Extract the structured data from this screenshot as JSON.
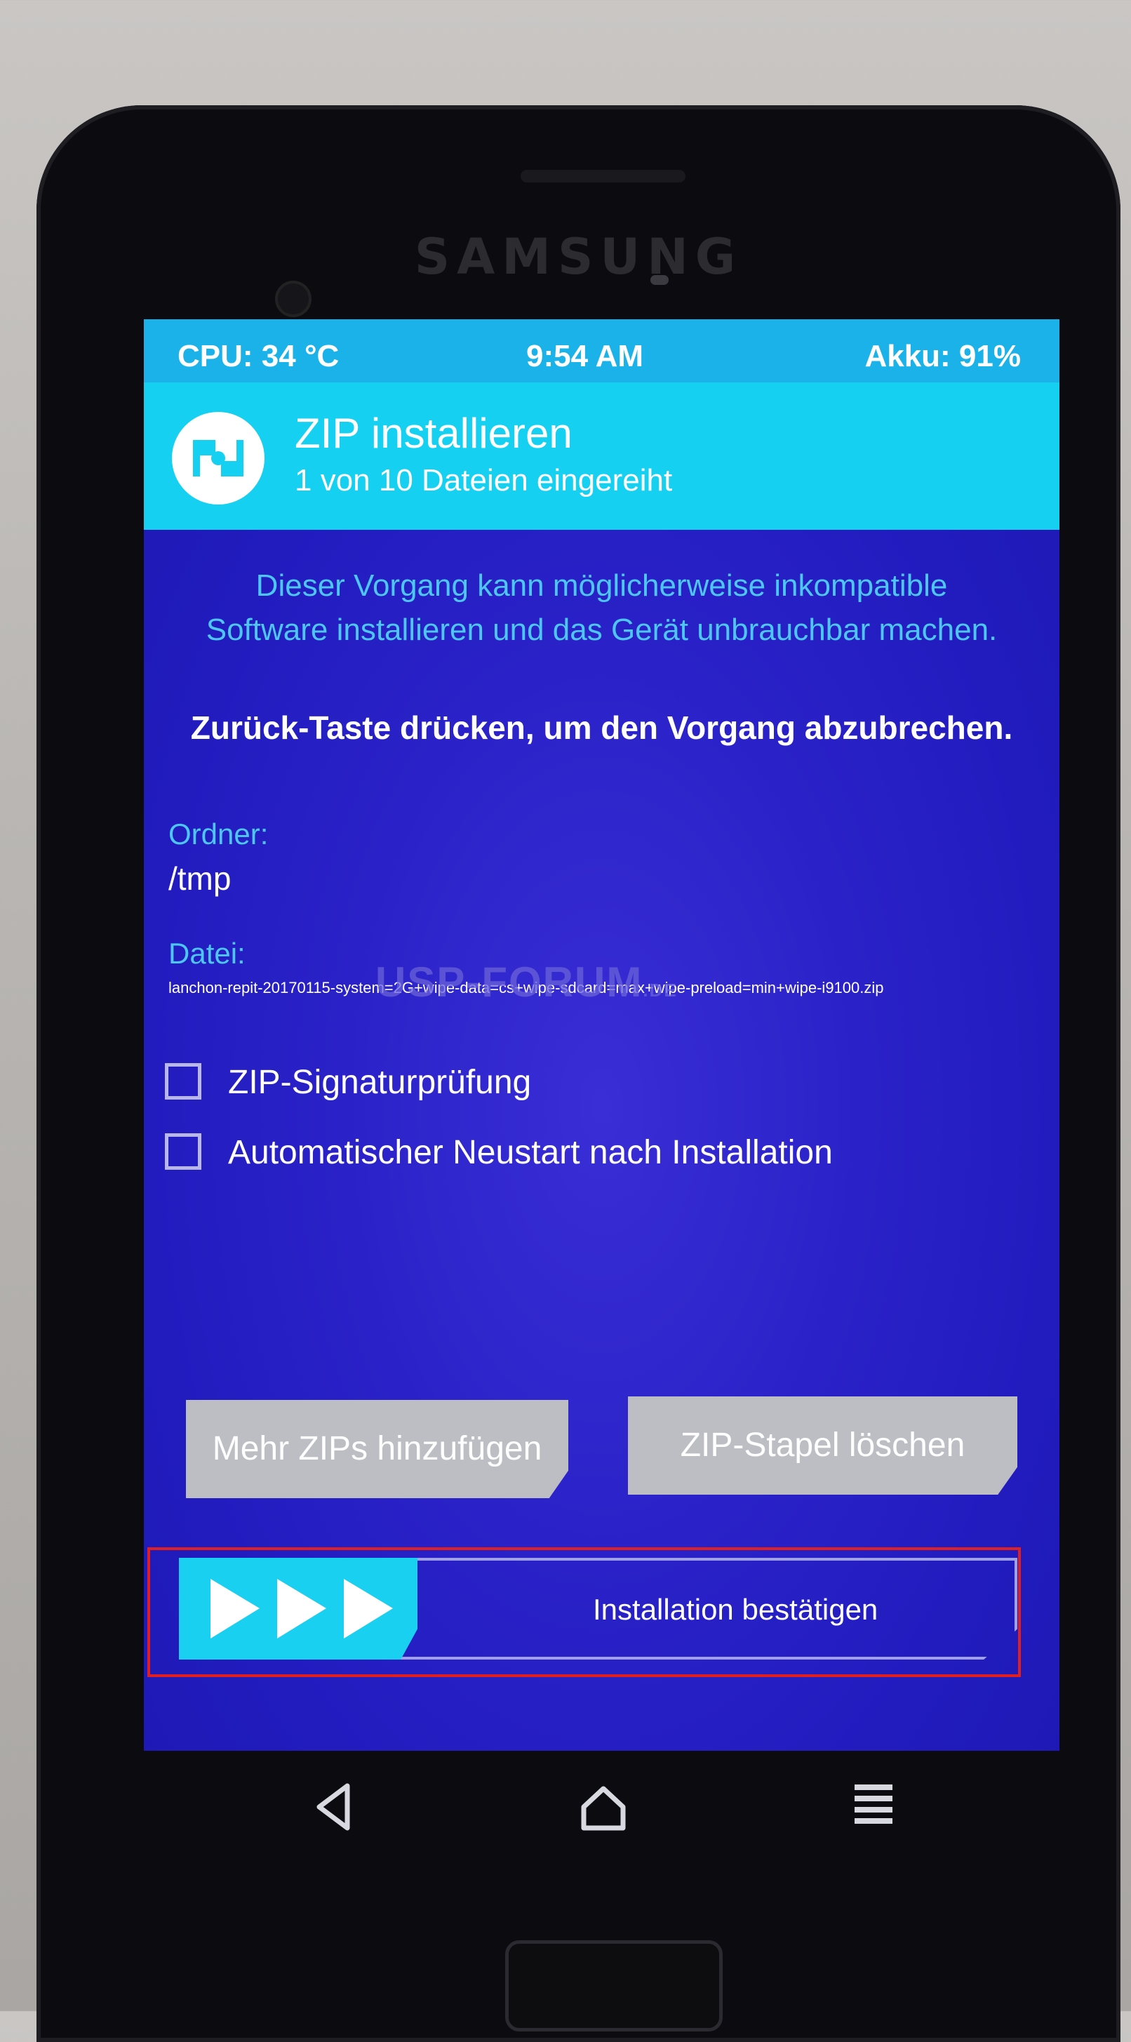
{
  "device": {
    "brand": "SAMSUNG"
  },
  "status_bar": {
    "cpu": "CPU: 34 °C",
    "time": "9:54 AM",
    "battery": "Akku: 91%"
  },
  "header": {
    "title": "ZIP installieren",
    "subtitle": "1 von 10 Dateien eingereiht"
  },
  "warning": {
    "line1": "Dieser Vorgang kann möglicherweise inkompatible",
    "line2": "Software installieren und das Gerät unbrauchbar machen.",
    "back_hint": "Zurück-Taste drücken, um den Vorgang abzubrechen."
  },
  "folder": {
    "label": "Ordner:",
    "value": "/tmp"
  },
  "file": {
    "label": "Datei:",
    "value": "lanchon-repit-20170115-system=2G+wipe-data=cs+wipe-sdcard=max+wipe-preload=min+wipe-i9100.zip"
  },
  "watermark": {
    "text": "USP-FORUM",
    "suffix": ".DE"
  },
  "options": [
    {
      "label": "ZIP-Signaturprüfung",
      "checked": false
    },
    {
      "label": "Automatischer Neustart nach Installation",
      "checked": false
    }
  ],
  "buttons": {
    "add_more": "Mehr ZIPs hinzufügen",
    "clear_queue": "ZIP-Stapel löschen"
  },
  "swipe": {
    "label": "Installation bestätigen"
  },
  "colors": {
    "screen_bg": "#221cbf",
    "header_bg": "#15d0f0",
    "accent_text": "#4ec6f2",
    "highlight_box": "#e02020"
  },
  "icons": [
    "twrp-logo-icon",
    "swipe-arrows-icon",
    "back-icon",
    "home-icon",
    "menu-icon"
  ]
}
